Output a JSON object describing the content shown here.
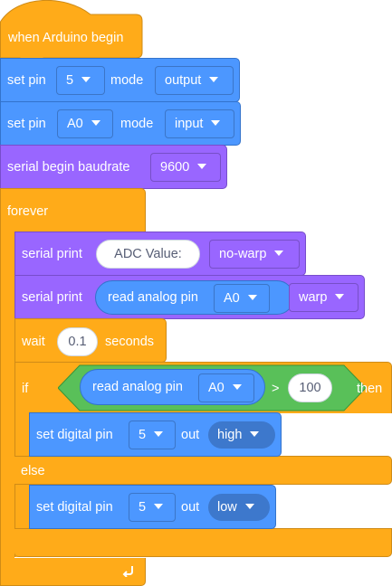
{
  "hat": {
    "label": "when Arduino begin"
  },
  "set_pin_1": {
    "label": "set pin",
    "pin": "5",
    "mode_label": "mode",
    "mode": "output"
  },
  "set_pin_2": {
    "label": "set pin",
    "pin": "A0",
    "mode_label": "mode",
    "mode": "input"
  },
  "serial_begin": {
    "label": "serial begin baudrate",
    "baud": "9600"
  },
  "forever": {
    "label": "forever",
    "loop_icon": "loop-arrow-icon"
  },
  "serial_print_1": {
    "label": "serial print",
    "text": "ADC Value:",
    "mode": "no-warp"
  },
  "serial_print_2": {
    "label": "serial print",
    "reporter_label": "read analog pin",
    "reporter_pin": "A0",
    "mode": "warp"
  },
  "wait": {
    "label": "wait",
    "value": "0.1",
    "unit": "seconds"
  },
  "if_block": {
    "if_label": "if",
    "reporter_label": "read analog pin",
    "reporter_pin": "A0",
    "operator": ">",
    "compare_value": "100",
    "then_label": "then",
    "else_label": "else"
  },
  "digital_high": {
    "label": "set digital pin",
    "pin": "5",
    "out_label": "out",
    "level": "high"
  },
  "digital_low": {
    "label": "set digital pin",
    "pin": "5",
    "out_label": "out",
    "level": "low"
  },
  "colors": {
    "events": "#ffab19",
    "motion": "#4c97ff",
    "looks": "#9966ff",
    "operators": "#59c059"
  }
}
